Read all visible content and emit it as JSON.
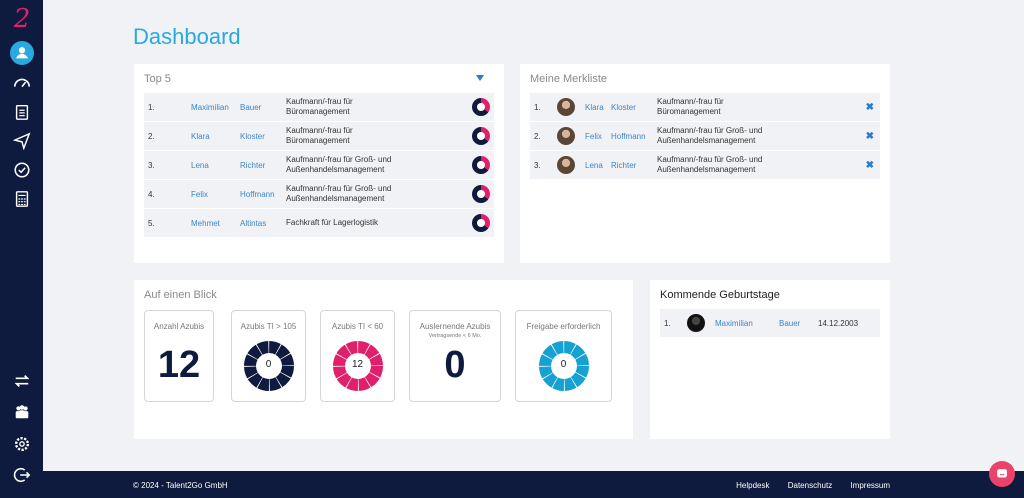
{
  "app": {
    "logo_text": "2"
  },
  "page_title": "Dashboard",
  "sidebar": {
    "items": [
      {
        "icon": "user-icon",
        "active": true
      },
      {
        "icon": "gauge-icon"
      },
      {
        "icon": "clipboard-icon"
      },
      {
        "icon": "send-icon"
      },
      {
        "icon": "check-circle-icon"
      },
      {
        "icon": "calculator-icon"
      },
      {
        "icon": "swap-icon"
      },
      {
        "icon": "people-icon"
      },
      {
        "icon": "gear-icon"
      },
      {
        "icon": "logout-icon"
      }
    ]
  },
  "top5": {
    "title": "Top 5",
    "rows": [
      {
        "num": "1.",
        "first": "Maximilian",
        "last": "Bauer",
        "job": "Kaufmann/-frau für Büromanagement"
      },
      {
        "num": "2.",
        "first": "Klara",
        "last": "Kloster",
        "job": "Kaufmann/-frau für Büromanagement"
      },
      {
        "num": "3.",
        "first": "Lena",
        "last": "Richter",
        "job": "Kaufmann/-frau für Groß- und Außenhandelsmanagement"
      },
      {
        "num": "4.",
        "first": "Felix",
        "last": "Hoffmann",
        "job": "Kaufmann/-frau für Groß- und Außenhandelsmanagement"
      },
      {
        "num": "5.",
        "first": "Mehmet",
        "last": "Altintas",
        "job": "Fachkraft für Lagerlogistik"
      }
    ]
  },
  "merkliste": {
    "title": "Meine Merkliste",
    "rows": [
      {
        "num": "1.",
        "first": "Klara",
        "last": "Kloster",
        "job": "Kaufmann/-frau für Büromanagement"
      },
      {
        "num": "2.",
        "first": "Felix",
        "last": "Hoffmann",
        "job": "Kaufmann/-frau für Groß- und Außenhandelsmanagement"
      },
      {
        "num": "3.",
        "first": "Lena",
        "last": "Richter",
        "job": "Kaufmann/-frau für Groß- und Außenhandelsmanagement"
      }
    ]
  },
  "blick": {
    "title": "Auf einen Blick",
    "kpis": [
      {
        "label": "Anzahl Azubis",
        "sub": "",
        "value": "12",
        "kind": "number"
      },
      {
        "label": "Azubis TI > 105",
        "sub": "",
        "value": "0",
        "kind": "donut",
        "color": "#0e1a3e"
      },
      {
        "label": "Azubis TI < 60",
        "sub": "",
        "value": "12",
        "kind": "donut",
        "color": "#e0206b"
      },
      {
        "label": "Auslernende Azubis",
        "sub": "Vertragsende < 6 Mo.",
        "value": "0",
        "kind": "number"
      },
      {
        "label": "Freigabe erforderlich",
        "sub": "",
        "value": "0",
        "kind": "donut",
        "color": "#16a1d3"
      }
    ]
  },
  "birthdays": {
    "title": "Kommende Geburtstage",
    "rows": [
      {
        "num": "1.",
        "first": "Maximilian",
        "last": "Bauer",
        "date": "14.12.2003"
      }
    ]
  },
  "footer": {
    "copyright": "© 2024 - Talent2Go GmbH",
    "links": [
      "Helpdesk",
      "Datenschutz",
      "Impressum"
    ]
  }
}
